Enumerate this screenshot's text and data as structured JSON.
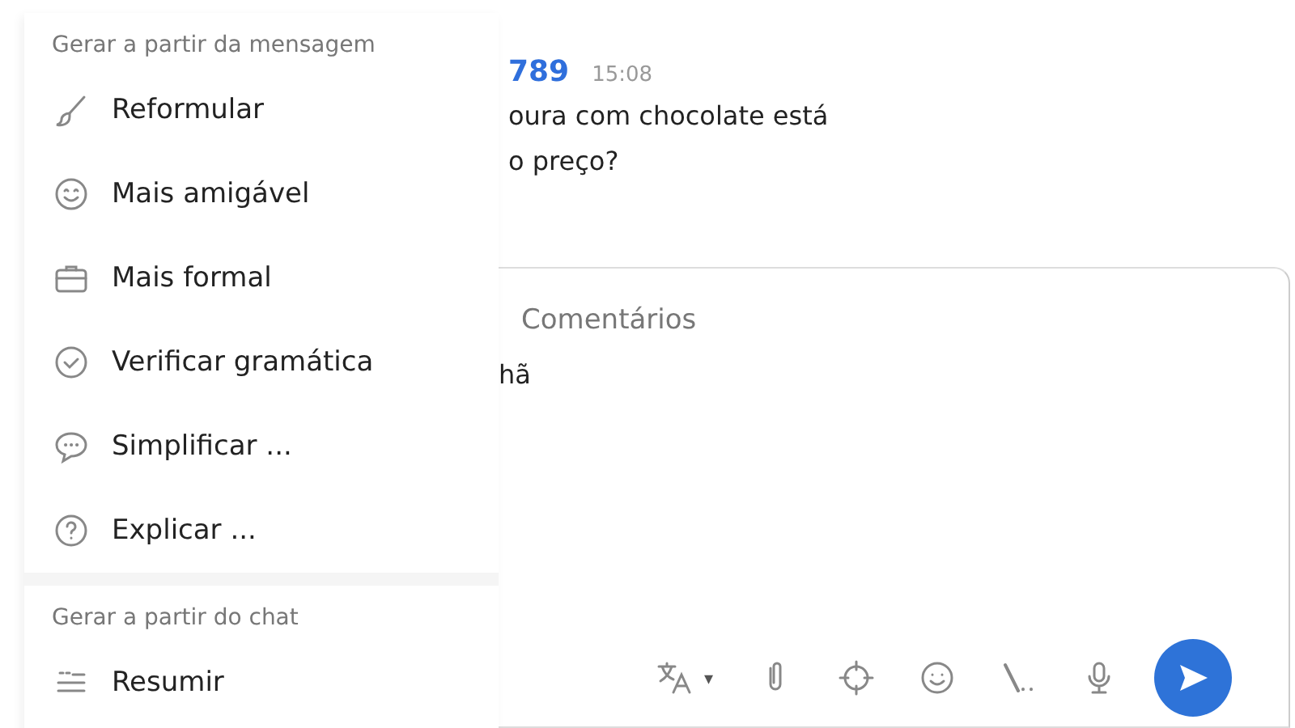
{
  "chat": {
    "message": {
      "sender": "789",
      "time": "15:08",
      "lines": [
        "oura com chocolate está",
        "o preço?"
      ]
    }
  },
  "composer": {
    "tab": "Comentários",
    "text": "hã",
    "translate_caret": "▾"
  },
  "ai_menu": {
    "sections": [
      {
        "title": "Gerar a partir da mensagem",
        "items": [
          {
            "label": "Reformular"
          },
          {
            "label": "Mais amigável"
          },
          {
            "label": "Mais formal"
          },
          {
            "label": "Verificar gramática"
          },
          {
            "label": "Simplificar ..."
          },
          {
            "label": "Explicar ..."
          }
        ]
      },
      {
        "title": "Gerar a partir do chat",
        "items": [
          {
            "label": "Resumir"
          }
        ]
      }
    ]
  }
}
